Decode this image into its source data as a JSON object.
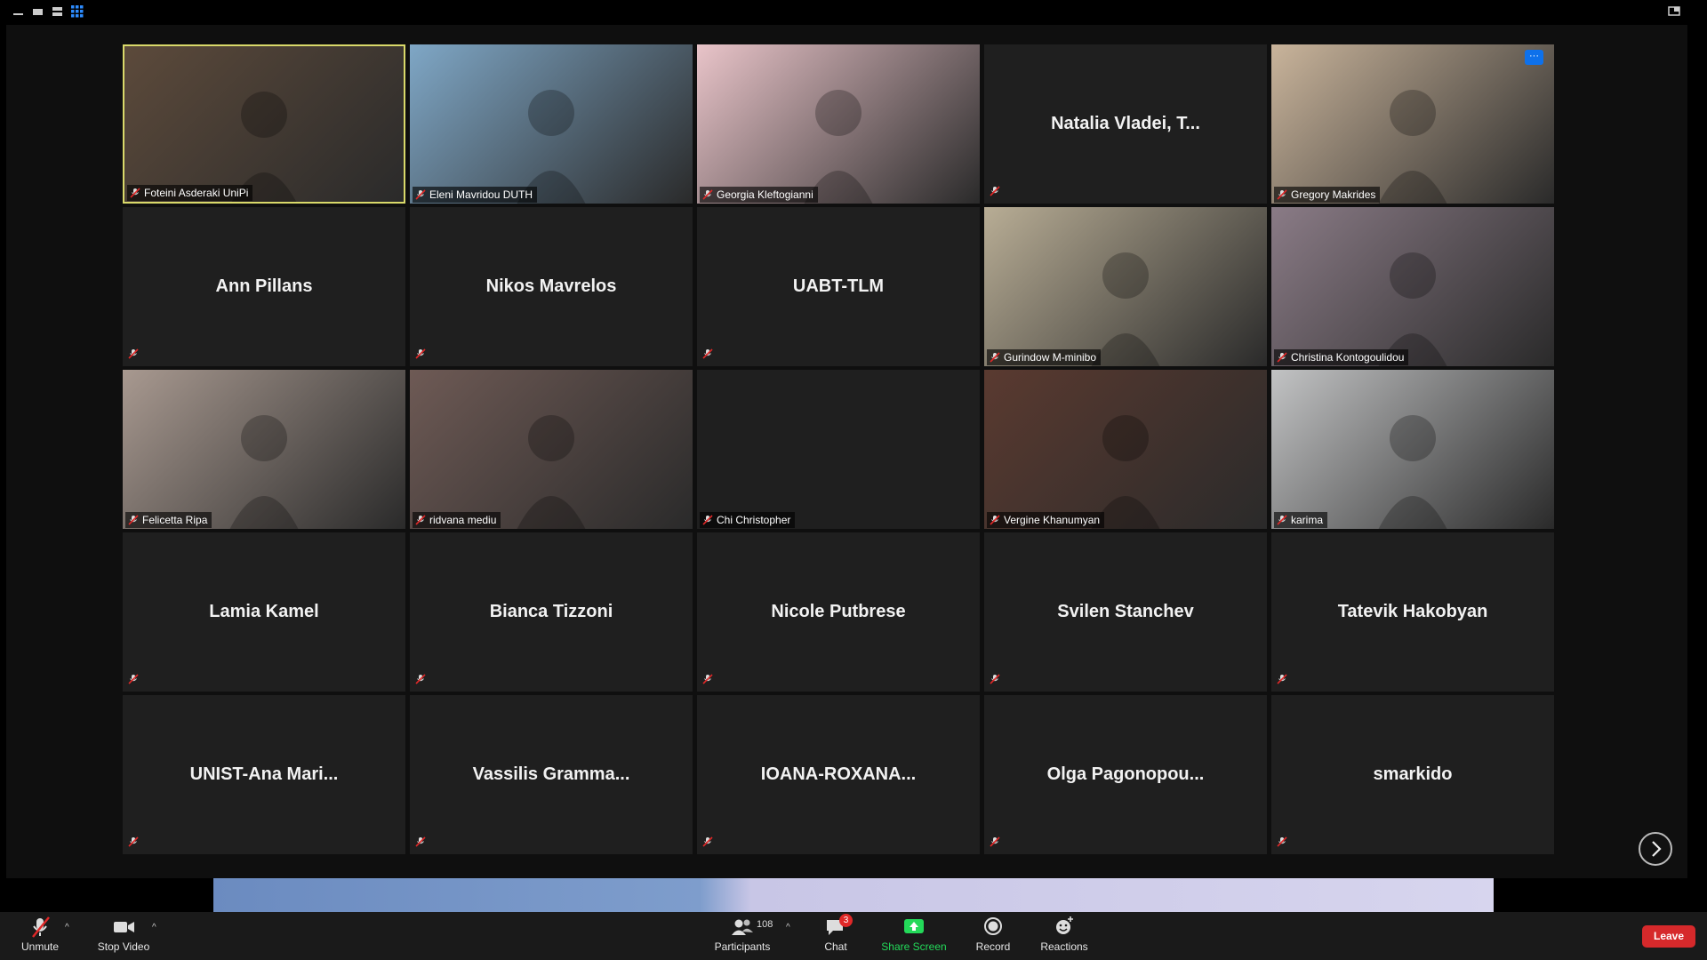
{
  "participants_grid": [
    {
      "name": "Foteini Asderaki UniPi",
      "display": "",
      "video": true,
      "speaking": true,
      "bg": "#5c4a3b"
    },
    {
      "name": "Eleni Mavridou DUTH",
      "display": "",
      "video": true,
      "speaking": false,
      "bg": "#7fa7c6"
    },
    {
      "name": "Georgia Kleftogianni",
      "display": "",
      "video": true,
      "speaking": false,
      "bg": "#e9c4c9"
    },
    {
      "name": "",
      "display": "Natalia Vladei, T...",
      "video": false,
      "speaking": false,
      "bg": "#1f1f1f"
    },
    {
      "name": "Gregory Makrides",
      "display": "",
      "video": true,
      "speaking": false,
      "bg": "#c9b49b",
      "more_label": "···"
    },
    {
      "name": "",
      "display": "Ann Pillans",
      "video": false,
      "speaking": false,
      "bg": "#1f1f1f"
    },
    {
      "name": "",
      "display": "Nikos Mavrelos",
      "video": false,
      "speaking": false,
      "bg": "#1f1f1f"
    },
    {
      "name": "",
      "display": "UABT-TLM",
      "video": false,
      "speaking": false,
      "bg": "#1f1f1f"
    },
    {
      "name": "Gurindow M-minibo",
      "display": "",
      "video": true,
      "speaking": false,
      "bg": "#b8ad95"
    },
    {
      "name": "Christina Kontogoulidou",
      "display": "",
      "video": true,
      "speaking": false,
      "bg": "#8a7b86"
    },
    {
      "name": "Felicetta Ripa",
      "display": "",
      "video": true,
      "speaking": false,
      "bg": "#a89990"
    },
    {
      "name": "ridvana mediu",
      "display": "",
      "video": true,
      "speaking": false,
      "bg": "#6e5a55"
    },
    {
      "name": "Chi Christopher",
      "display": "",
      "video": false,
      "speaking": false,
      "bg": "#1f1f1f"
    },
    {
      "name": "Vergine Khanumyan",
      "display": "",
      "video": true,
      "speaking": false,
      "bg": "#5a3a30"
    },
    {
      "name": "karima",
      "display": "",
      "video": true,
      "speaking": false,
      "bg": "#c2c3c4"
    },
    {
      "name": "",
      "display": "Lamia Kamel",
      "video": false,
      "speaking": false,
      "bg": "#1f1f1f"
    },
    {
      "name": "",
      "display": "Bianca Tizzoni",
      "video": false,
      "speaking": false,
      "bg": "#1f1f1f"
    },
    {
      "name": "",
      "display": "Nicole Putbrese",
      "video": false,
      "speaking": false,
      "bg": "#1f1f1f"
    },
    {
      "name": "",
      "display": "Svilen Stanchev",
      "video": false,
      "speaking": false,
      "bg": "#1f1f1f"
    },
    {
      "name": "",
      "display": "Tatevik Hakobyan",
      "video": false,
      "speaking": false,
      "bg": "#1f1f1f"
    },
    {
      "name": "",
      "display": "UNIST-Ana  Mari...",
      "video": false,
      "speaking": false,
      "bg": "#1f1f1f"
    },
    {
      "name": "",
      "display": "Vassilis  Gramma...",
      "video": false,
      "speaking": false,
      "bg": "#1f1f1f"
    },
    {
      "name": "",
      "display": "IOANA-ROXANA...",
      "video": false,
      "speaking": false,
      "bg": "#1f1f1f"
    },
    {
      "name": "",
      "display": "Olga  Pagonopou...",
      "video": false,
      "speaking": false,
      "bg": "#1f1f1f"
    },
    {
      "name": "",
      "display": "smarkido",
      "video": false,
      "speaking": false,
      "bg": "#1f1f1f"
    }
  ],
  "toolbar": {
    "unmute": "Unmute",
    "stop_video": "Stop Video",
    "participants": "Participants",
    "participants_count": "108",
    "chat": "Chat",
    "chat_badge": "3",
    "share_screen": "Share Screen",
    "record": "Record",
    "reactions": "Reactions",
    "leave": "Leave"
  },
  "colors": {
    "share_green": "#23d959",
    "leave_red": "#d6292b",
    "speaker_border": "#d9d96a",
    "accent_blue": "#0e71eb"
  }
}
